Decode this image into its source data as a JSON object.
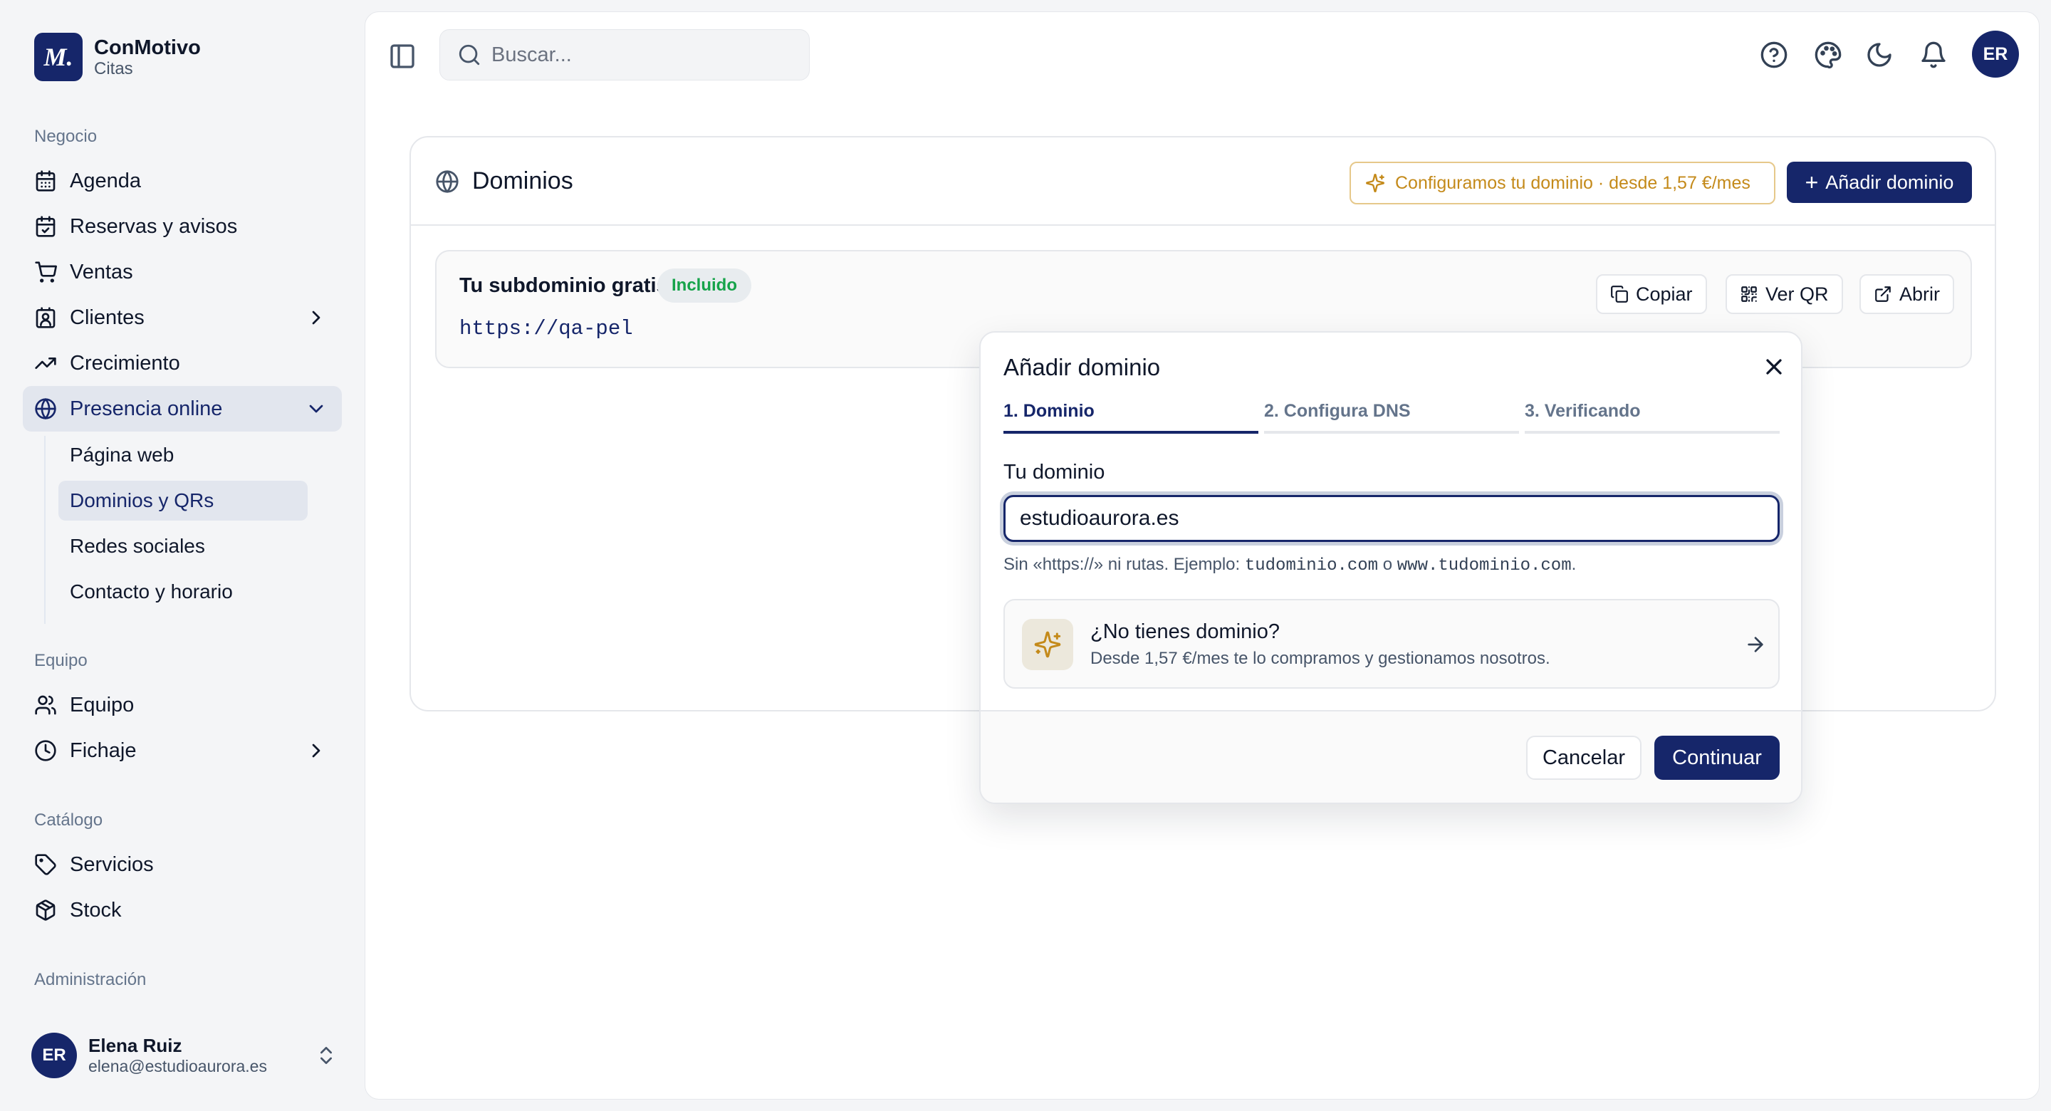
{
  "brand": {
    "logo_text": "M.",
    "name": "ConMotivo",
    "subtitle": "Citas"
  },
  "sidebar": {
    "sections": [
      {
        "label": "Negocio"
      },
      {
        "label": "Equipo"
      },
      {
        "label": "Catálogo"
      },
      {
        "label": "Administración"
      }
    ],
    "items": [
      {
        "label": "Agenda",
        "icon": "calendar-icon"
      },
      {
        "label": "Reservas y avisos",
        "icon": "calendar-check-icon"
      },
      {
        "label": "Ventas",
        "icon": "cart-icon"
      },
      {
        "label": "Clientes",
        "icon": "contact-icon"
      },
      {
        "label": "Crecimiento",
        "icon": "trending-up-icon"
      },
      {
        "label": "Presencia online",
        "icon": "globe-icon"
      },
      {
        "label": "Equipo",
        "icon": "users-icon"
      },
      {
        "label": "Fichaje",
        "icon": "clock-icon"
      },
      {
        "label": "Servicios",
        "icon": "tag-icon"
      },
      {
        "label": "Stock",
        "icon": "package-icon"
      }
    ],
    "subitems": [
      {
        "label": "Página web"
      },
      {
        "label": "Dominios y QRs"
      },
      {
        "label": "Redes sociales"
      },
      {
        "label": "Contacto y horario"
      }
    ]
  },
  "user": {
    "initials": "ER",
    "name": "Elena Ruiz",
    "email": "elena@estudioaurora.es"
  },
  "topbar": {
    "search_placeholder": "Buscar...",
    "avatar_initials": "ER"
  },
  "domains": {
    "title": "Dominios",
    "promo_button": "Configuramos tu dominio · desde 1,57 €/mes",
    "add_button": "Añadir dominio",
    "subdomain": {
      "title": "Tu subdominio gratis",
      "badge": "Incluido",
      "url": "https://qa-pel",
      "copy_label": "Copiar",
      "qr_label": "Ver QR",
      "open_label": "Abrir"
    }
  },
  "modal": {
    "title": "Añadir dominio",
    "steps": [
      "1. Dominio",
      "2. Configura DNS",
      "3. Verificando"
    ],
    "field_label": "Tu dominio",
    "input_value": "estudioaurora.es",
    "hint_prefix": "Sin «https://» ni rutas. Ejemplo: ",
    "hint_example1": "tudominio.com",
    "hint_mid": " o ",
    "hint_example2": "www.tudominio.com",
    "hint_suffix": ".",
    "promo_title": "¿No tienes dominio?",
    "promo_desc": "Desde 1,57 €/mes te lo compramos y gestionamos nosotros.",
    "cancel_label": "Cancelar",
    "continue_label": "Continuar"
  },
  "colors": {
    "accent": "#16266a",
    "active_bg": "#e2e6ee",
    "promo": "#c48a1a",
    "badge_green": "#16a34a"
  }
}
